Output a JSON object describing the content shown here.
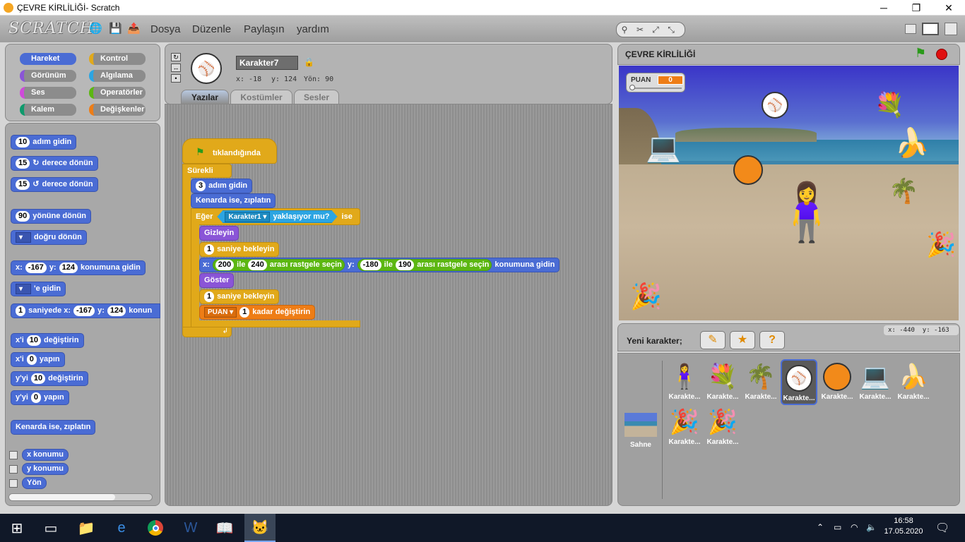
{
  "window": {
    "title": "ÇEVRE KİRLİLİĞİ- Scratch",
    "min": "─",
    "max": "❐",
    "close": "✕"
  },
  "menu": {
    "logo": "SCRATCH",
    "items": [
      "Dosya",
      "Düzenle",
      "Paylaşın",
      "yardım"
    ]
  },
  "categories": [
    {
      "label": "Hareket",
      "color": "#4a6cd4"
    },
    {
      "label": "Kontrol",
      "color": "#e1a91a"
    },
    {
      "label": "Görünüm",
      "color": "#8a55d7"
    },
    {
      "label": "Algılama",
      "color": "#2ca5e2"
    },
    {
      "label": "Ses",
      "color": "#cf4ad9"
    },
    {
      "label": "Operatörler",
      "color": "#5cb712"
    },
    {
      "label": "Kalem",
      "color": "#0e9a6c"
    },
    {
      "label": "Değişkenler",
      "color": "#ee7d16"
    }
  ],
  "palette": {
    "move": {
      "n": "10",
      "t": "adım gidin"
    },
    "turn_right": {
      "n": "15",
      "t": "derece dönün"
    },
    "turn_left": {
      "n": "15",
      "t": "derece dönün"
    },
    "point_dir": {
      "n": "90",
      "t": "yönüne dönün"
    },
    "point_towards": {
      "t": "doğru dönün"
    },
    "goto_xy": {
      "x": "-167",
      "y": "124",
      "t": "konumuna gidin",
      "xl": "x:",
      "yl": "y:"
    },
    "goto": {
      "t": "'e gidin"
    },
    "glide": {
      "n": "1",
      "t1": "saniyede x:",
      "x": "-167",
      "yl": "y:",
      "y": "124",
      "t2": "konun"
    },
    "change_x": {
      "pre": "x'i",
      "n": "10",
      "t": "değiştirin"
    },
    "set_x": {
      "pre": "x'i",
      "n": "0",
      "t": "yapın"
    },
    "change_y": {
      "pre": "y'yi",
      "n": "10",
      "t": "değiştirin"
    },
    "set_y": {
      "pre": "y'yi",
      "n": "0",
      "t": "yapın"
    },
    "bounce": "Kenarda ise, zıplatın",
    "xpos": "x konumu",
    "ypos": "y konumu",
    "dir": "Yön"
  },
  "sprite": {
    "name": "Karakter7",
    "x": "x: -18",
    "y": "y: 124",
    "dir": "Yön: 90"
  },
  "tabs": [
    "Yazılar",
    "Kostümler",
    "Sesler"
  ],
  "script": {
    "hat": "tıklandığında",
    "forever": "Sürekli",
    "move": {
      "n": "3",
      "t": "adım gidin"
    },
    "bounce": "Kenarda ise, zıplatın",
    "if": {
      "pre": "Eğer",
      "sprite": "Karakter1",
      "cond": "yaklaşıyor mu?",
      "post": "ise"
    },
    "hide": "Gizleyin",
    "wait1": {
      "n": "1",
      "t": "saniye bekleyin"
    },
    "goto": {
      "xl": "x:",
      "a": "200",
      "ile": "ile",
      "b": "240",
      "r": "arası rastgele seçin",
      "yl": "y:",
      "c": "-180",
      "ile2": "ile",
      "d": "190",
      "r2": "arası rastgele seçin",
      "t": "konumuna gidin"
    },
    "show": "Göster",
    "wait2": {
      "n": "1",
      "t": "saniye bekleyin"
    },
    "change": {
      "var": "PUAN",
      "n": "1",
      "t": "kadar değiştirin"
    }
  },
  "stage": {
    "title": "ÇEVRE KİRLİLİĞİ",
    "var_label": "PUAN",
    "var_value": "0"
  },
  "newsprite": {
    "label": "Yeni karakter;",
    "coords_x": "x: -440",
    "coords_y": "y: -163"
  },
  "sprites": [
    {
      "name": "Karakte...",
      "icon": "girl-icon"
    },
    {
      "name": "Karakte...",
      "icon": "flowers-icon"
    },
    {
      "name": "Karakte...",
      "icon": "tree-icon"
    },
    {
      "name": "Karakte...",
      "icon": "baseball-icon"
    },
    {
      "name": "Karakte...",
      "icon": "basketball-icon"
    },
    {
      "name": "Karakte...",
      "icon": "laptop-icon"
    },
    {
      "name": "Karakte...",
      "icon": "banana-icon"
    },
    {
      "name": "Karakte...",
      "icon": "party-hat-icon"
    },
    {
      "name": "Karakte...",
      "icon": "party-hat-icon"
    }
  ],
  "stage_thumb": "Sahne",
  "taskbar": {
    "time": "16:58",
    "date": "17.05.2020"
  }
}
